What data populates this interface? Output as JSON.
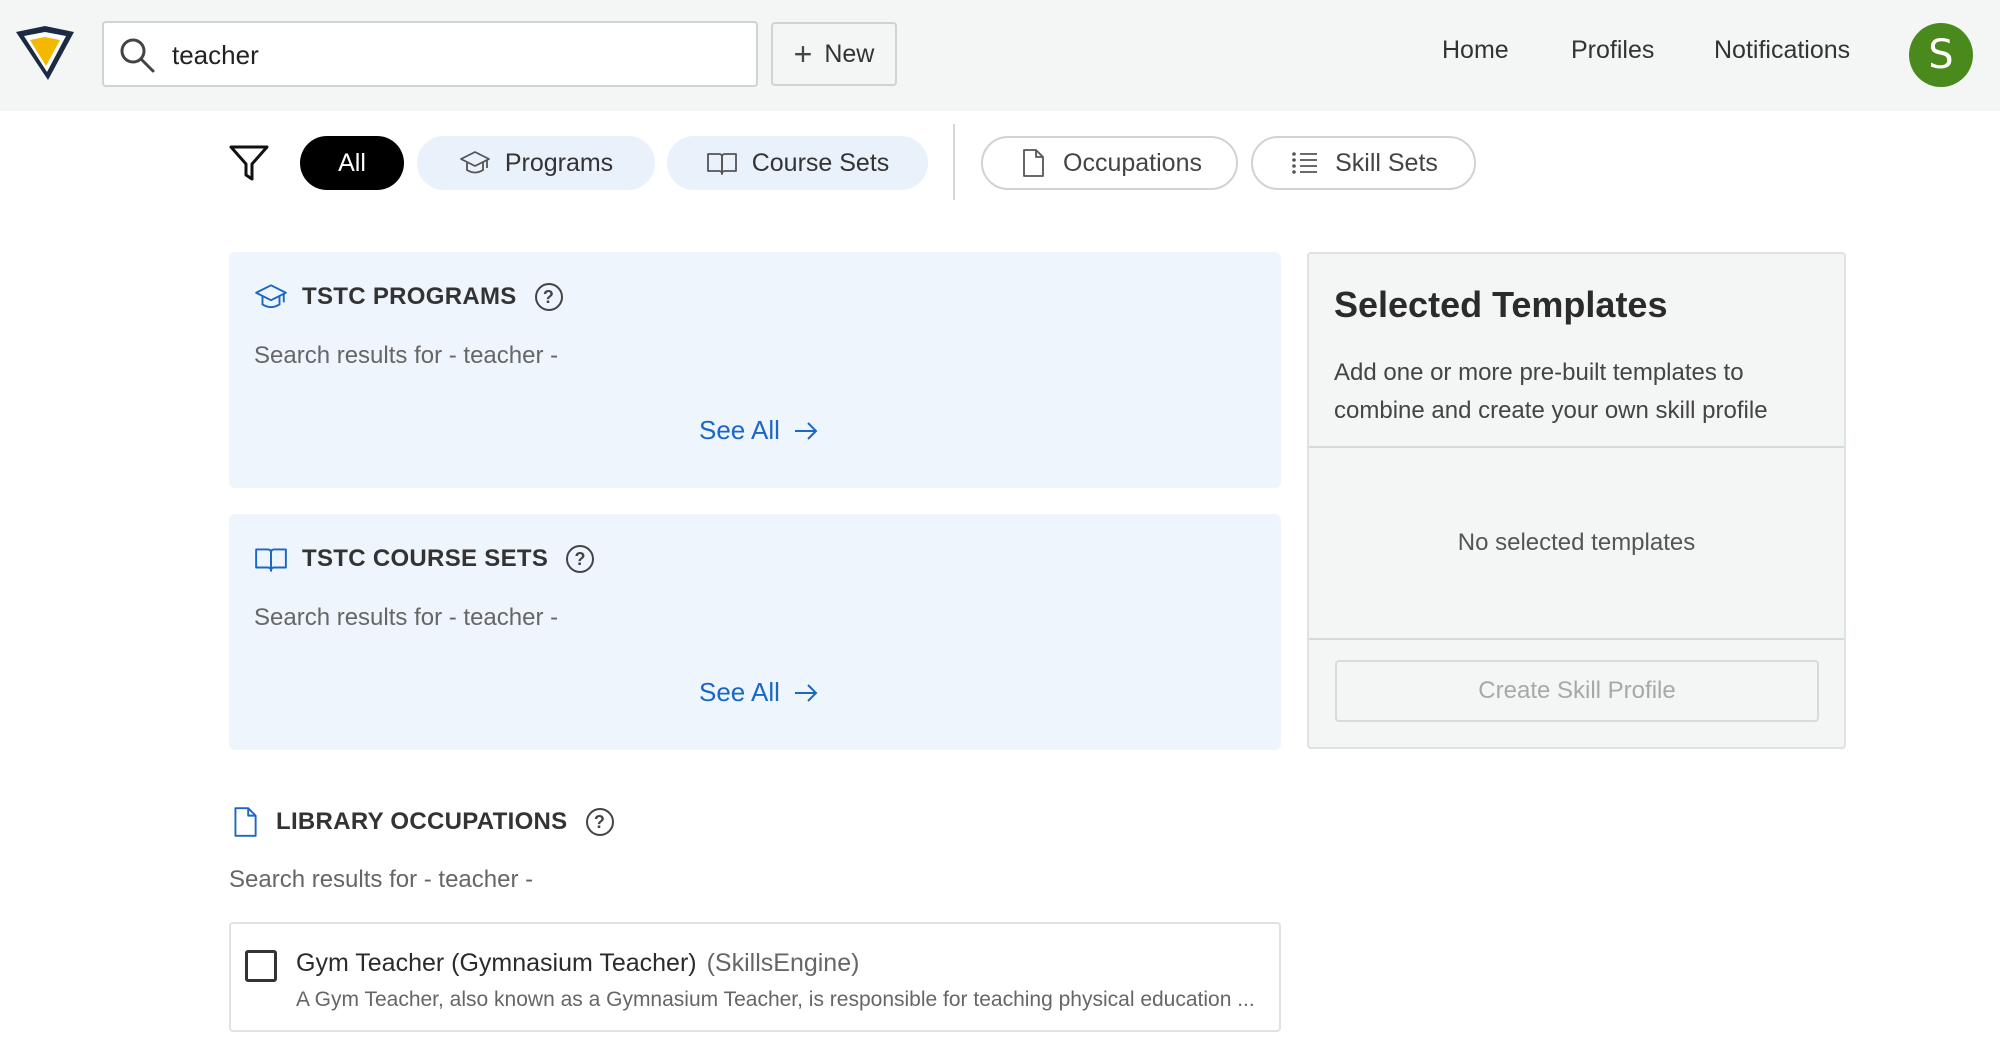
{
  "header": {
    "search": {
      "value": "teacher",
      "placeholder": ""
    },
    "new_label": "New",
    "nav": {
      "home": "Home",
      "profiles": "Profiles",
      "notifications": "Notifications"
    },
    "avatar_initial": "S"
  },
  "filters": {
    "all": "All",
    "programs": "Programs",
    "course_sets": "Course Sets",
    "occupations": "Occupations",
    "skill_sets": "Skill Sets"
  },
  "sections": {
    "programs": {
      "title": "TSTC PROGRAMS",
      "results": "Search results for - teacher -",
      "see_all": "See All"
    },
    "course_sets": {
      "title": "TSTC COURSE SETS",
      "results": "Search results for - teacher -",
      "see_all": "See All"
    },
    "occupations": {
      "title": "LIBRARY OCCUPATIONS",
      "results": "Search results for - teacher -",
      "items": [
        {
          "title": "Gym Teacher (Gymnasium Teacher)",
          "source": "(SkillsEngine)",
          "description": "A Gym Teacher, also known as a Gymnasium Teacher, is responsible for teaching physical education ..."
        }
      ]
    }
  },
  "templates_panel": {
    "title": "Selected Templates",
    "description": "Add one or more pre-built templates to combine and create your own skill profile",
    "empty": "No selected templates",
    "create_label": "Create Skill Profile"
  },
  "colors": {
    "accent_link": "#1b67c4",
    "avatar_bg": "#4a8a1c",
    "section_bg": "#eef5fd",
    "chip_active": "#000000"
  },
  "icons": [
    "logo-icon",
    "search-icon",
    "plus-icon",
    "filter-icon",
    "graduation-cap-icon",
    "book-icon",
    "document-icon",
    "list-icon",
    "help-icon",
    "arrow-right-icon"
  ]
}
